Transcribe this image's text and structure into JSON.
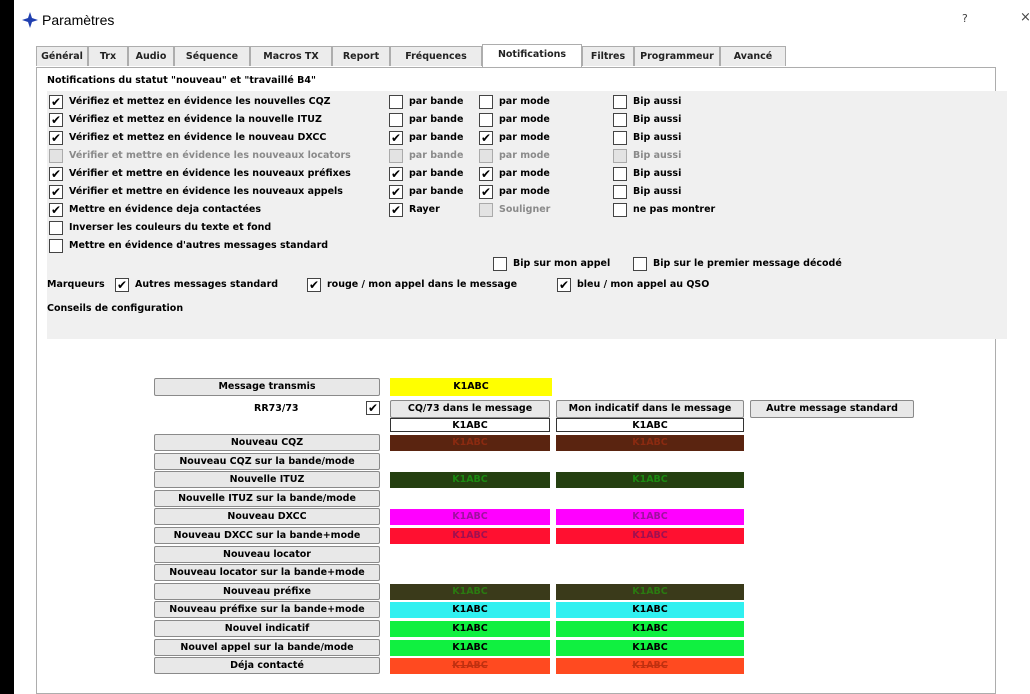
{
  "window": {
    "title": "Paramètres",
    "help": "?",
    "close": "×"
  },
  "tabs": [
    {
      "label": "Général",
      "active": false
    },
    {
      "label": "Trx",
      "active": false
    },
    {
      "label": "Audio",
      "active": false
    },
    {
      "label": "Séquence",
      "active": false
    },
    {
      "label": "Macros TX",
      "active": false
    },
    {
      "label": "Report",
      "active": false
    },
    {
      "label": "Fréquences",
      "active": false
    },
    {
      "label": "Notifications",
      "active": true
    },
    {
      "label": "Filtres",
      "active": false
    },
    {
      "label": "Programmeur",
      "active": false
    },
    {
      "label": "Avancé",
      "active": false
    }
  ],
  "notifications": {
    "group_title": "Notifications du statut \"nouveau\" et \"travaillé B4\"",
    "rows": [
      {
        "label": "Vérifiez et mettez en évidence les nouvelles CQZ",
        "checked": true,
        "enabled": true,
        "per_band": {
          "label": "par bande",
          "checked": false
        },
        "per_mode": {
          "label": "par mode",
          "checked": false
        },
        "beep": {
          "label": "Bip aussi",
          "checked": false
        }
      },
      {
        "label": "Vérifiez et mettez en évidence la nouvelle ITUZ",
        "checked": true,
        "enabled": true,
        "per_band": {
          "label": "par bande",
          "checked": false
        },
        "per_mode": {
          "label": "par mode",
          "checked": false
        },
        "beep": {
          "label": "Bip aussi",
          "checked": false
        }
      },
      {
        "label": "Vérifiez et mettez en évidence le nouveau DXCC",
        "checked": true,
        "enabled": true,
        "per_band": {
          "label": "par bande",
          "checked": true
        },
        "per_mode": {
          "label": "par mode",
          "checked": true
        },
        "beep": {
          "label": "Bip aussi",
          "checked": false
        }
      },
      {
        "label": "Vérifier et mettre en évidence les nouveaux locators",
        "checked": false,
        "enabled": false,
        "per_band": {
          "label": "par bande",
          "checked": false
        },
        "per_mode": {
          "label": "par mode",
          "checked": false
        },
        "beep": {
          "label": "Bip aussi",
          "checked": false
        }
      },
      {
        "label": "Vérifier et mettre en évidence les nouveaux préfixes",
        "checked": true,
        "enabled": true,
        "per_band": {
          "label": "par bande",
          "checked": true
        },
        "per_mode": {
          "label": "par mode",
          "checked": true
        },
        "beep": {
          "label": "Bip aussi",
          "checked": false
        }
      },
      {
        "label": "Vérifier et mettre en évidence les nouveaux appels",
        "checked": true,
        "enabled": true,
        "per_band": {
          "label": "par bande",
          "checked": true
        },
        "per_mode": {
          "label": "par mode",
          "checked": true
        },
        "beep": {
          "label": "Bip aussi",
          "checked": false
        }
      }
    ],
    "worked": {
      "label": "Mettre en évidence deja contactées",
      "checked": true,
      "strike": {
        "label": "Rayer",
        "checked": true
      },
      "underline": {
        "label": "Souligner",
        "checked": false
      },
      "hide": {
        "label": "ne pas montrer",
        "checked": false
      }
    },
    "invert": {
      "label": "Inverser les couleurs du texte et fond",
      "checked": false
    },
    "other_std": {
      "label": "Mettre en évidence d'autres messages standard",
      "checked": false
    },
    "beep_my_call": {
      "label": "Bip sur mon appel",
      "checked": false
    },
    "beep_first_decoded": {
      "label": "Bip sur le premier message décodé",
      "checked": false
    }
  },
  "markers": {
    "label": "Marqueurs",
    "items": [
      {
        "label": "Autres messages standard",
        "checked": true
      },
      {
        "label": "rouge / mon appel dans le message",
        "checked": true
      },
      {
        "label": "bleu / mon appel au QSO",
        "checked": true
      }
    ]
  },
  "config_hints": "Conseils de configuration",
  "colors": {
    "tx_message": {
      "label": "Message transmis",
      "sample": "K1ABC",
      "bg": "#ffff00",
      "fg": "#000000"
    },
    "rr73": {
      "label": "RR73/73",
      "checked": true
    },
    "cq73_button": "CQ/73 dans le message",
    "mycall_button": "Mon indicatif dans le message",
    "other_button": "Autre message standard",
    "header_samples": [
      "K1ABC",
      "K1ABC"
    ],
    "rows": [
      {
        "label": "Nouveau CQZ",
        "samples": [
          "K1ABC",
          "K1ABC"
        ],
        "bg": "#5a2410",
        "fg": "#8a2a10"
      },
      {
        "label": "Nouveau CQZ sur la bande/mode",
        "samples": [
          "",
          ""
        ],
        "bg": "",
        "fg": ""
      },
      {
        "label": "Nouvelle ITUZ",
        "samples": [
          "K1ABC",
          "K1ABC"
        ],
        "bg": "#254010",
        "fg": "#1a8a10"
      },
      {
        "label": "Nouvelle ITUZ sur la bande/mode",
        "samples": [
          "",
          ""
        ],
        "bg": "",
        "fg": ""
      },
      {
        "label": "Nouveau DXCC",
        "samples": [
          "K1ABC",
          "K1ABC"
        ],
        "bg": "#ff00ff",
        "fg": "#a010a0"
      },
      {
        "label": "Nouveau DXCC sur la bande+mode",
        "samples": [
          "K1ABC",
          "K1ABC"
        ],
        "bg": "#ff1030",
        "fg": "#a01050"
      },
      {
        "label": "Nouveau locator",
        "samples": [
          "",
          ""
        ],
        "bg": "",
        "fg": ""
      },
      {
        "label": "Nouveau locator  sur la bande+mode",
        "samples": [
          "",
          ""
        ],
        "bg": "",
        "fg": ""
      },
      {
        "label": "Nouveau préfixe",
        "samples": [
          "K1ABC",
          "K1ABC"
        ],
        "bg": "#3a3a1a",
        "fg": "#2a7a10"
      },
      {
        "label": "Nouveau préfixe sur la bande+mode",
        "samples": [
          "K1ABC",
          "K1ABC"
        ],
        "bg": "#30f0f0",
        "fg": "#000000"
      },
      {
        "label": "Nouvel indicatif",
        "samples": [
          "K1ABC",
          "K1ABC"
        ],
        "bg": "#10f040",
        "fg": "#000000"
      },
      {
        "label": "Nouvel appel sur la bande/mode",
        "samples": [
          "K1ABC",
          "K1ABC"
        ],
        "bg": "#10f040",
        "fg": "#000000"
      },
      {
        "label": "Déja contacté",
        "samples": [
          "K1ABC",
          "K1ABC"
        ],
        "bg": "#ff4a20",
        "fg": "#c03010",
        "strike": true
      }
    ]
  }
}
